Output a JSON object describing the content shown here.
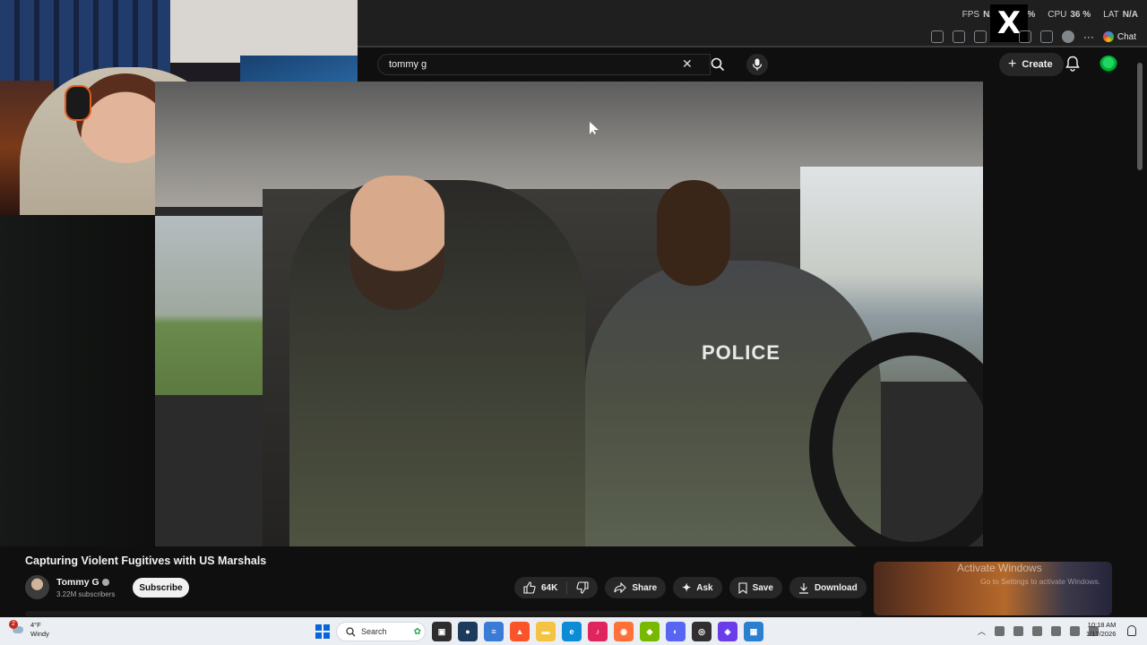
{
  "overlay": {
    "fps_label": "FPS",
    "fps_value": "N/A",
    "gpu_value": "%",
    "cpu_label": "CPU",
    "cpu_value": "36 %",
    "lat_label": "LAT",
    "lat_value": "N/A",
    "logo_text": "X"
  },
  "browser": {
    "chat_label": "Chat"
  },
  "youtube": {
    "search": {
      "value": "tommy g"
    },
    "create_label": "Create"
  },
  "video": {
    "vest_text": "POLICE",
    "title": "Capturing Violent Fugitives with US Marshals",
    "channel_name": "Tommy G",
    "subscribers": "3.22M subscribers",
    "subscribe_label": "Subscribe",
    "like_count": "64K",
    "share_label": "Share",
    "ask_label": "Ask",
    "save_label": "Save",
    "download_label": "Download",
    "more_label": "···"
  },
  "watermark": {
    "line1": "Activate Windows",
    "line2": "Go to Settings to activate Windows."
  },
  "taskbar": {
    "weather_badge": "2",
    "temperature": "4°F",
    "condition": "Windy",
    "search_label": "Search",
    "time": "10:18 AM",
    "date": "1/17/2026"
  },
  "colors": {
    "youtube_bg": "#0f0f0f",
    "pill_bg": "#272727",
    "taskbar_bg": "#ebeef2",
    "windows_blue": "#0a66d8"
  }
}
